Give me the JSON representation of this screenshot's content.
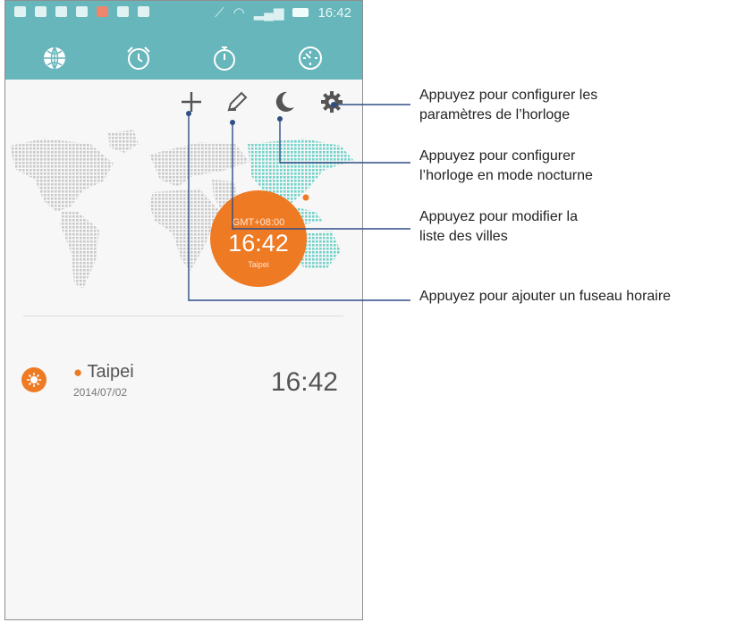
{
  "status_bar": {
    "time": "16:42",
    "notification_icons": [
      "sim-icon",
      "sd-card-icon",
      "image-icon",
      "message-icon",
      "missed-call-icon",
      "cloud-upload-icon",
      "clipboard-icon"
    ],
    "system_icons": [
      "no-signal-icon",
      "wifi-icon",
      "signal-bars-icon",
      "battery-icon"
    ]
  },
  "tabs": [
    {
      "icon": "globe-icon",
      "selected": true
    },
    {
      "icon": "alarm-clock-icon",
      "selected": false
    },
    {
      "icon": "stopwatch-icon",
      "selected": false
    },
    {
      "icon": "timer-icon",
      "selected": false
    }
  ],
  "toolbar_icons": [
    "add-icon",
    "edit-icon",
    "night-mode-icon",
    "settings-icon"
  ],
  "world_clock": {
    "gmt": "GMT+08:00",
    "time": "16:42",
    "city": "Taipei"
  },
  "cities": [
    {
      "name": "Taipei",
      "date": "2014/07/02",
      "time": "16:42"
    }
  ],
  "annotations": {
    "settings_line1": "Appuyez pour configurer les",
    "settings_line2": "paramètres de l’horloge",
    "night_line1": "Appuyez pour configurer",
    "night_line2": "l’horloge en mode nocturne",
    "edit_line1": "Appuyez pour modifier la",
    "edit_line2": "liste des villes",
    "add_line1": "Appuyez pour ajouter un fuseau horaire"
  },
  "colors": {
    "accent": "#ef7a24",
    "header": "#66b6bb",
    "map_highlight": "#71d2c9",
    "callout_line": "#2e4e86"
  }
}
